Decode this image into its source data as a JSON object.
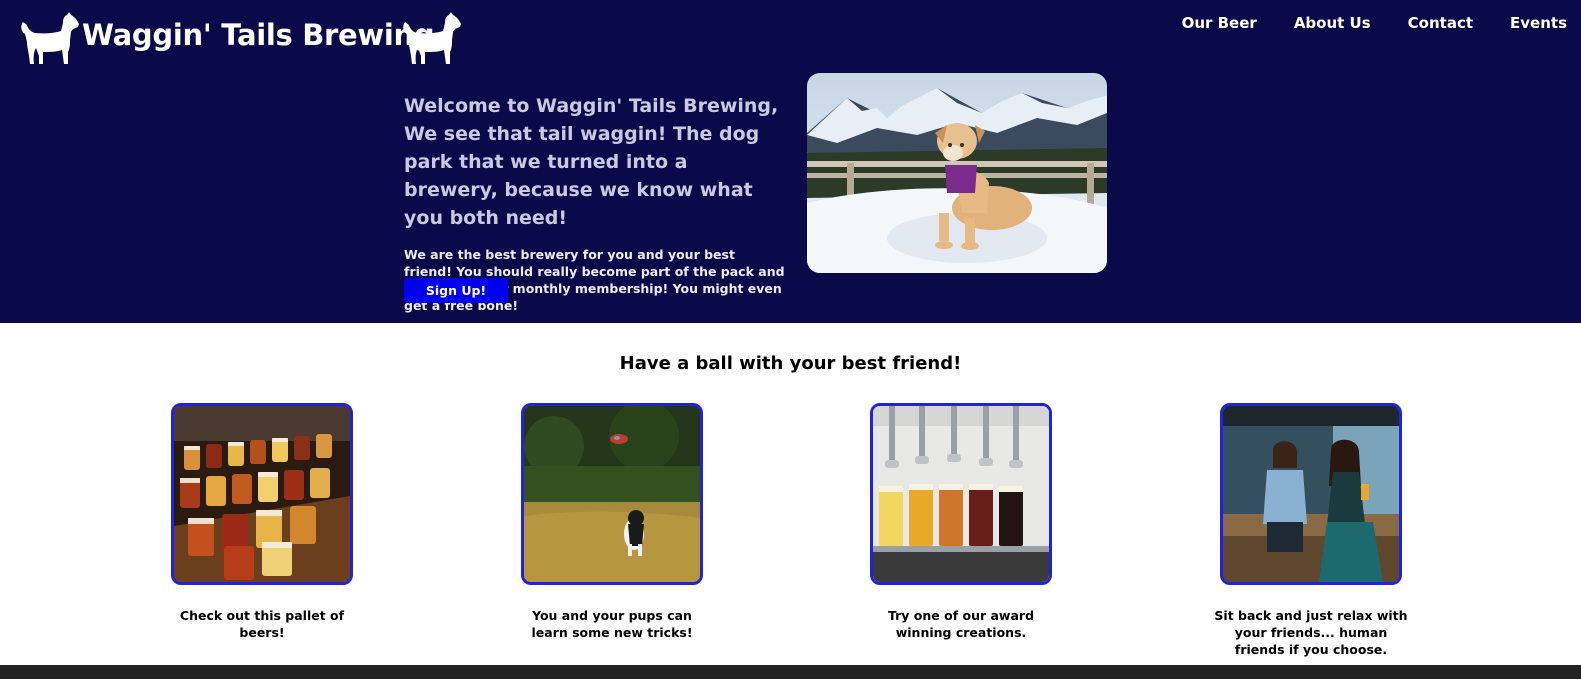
{
  "brand": {
    "title": "Waggin' Tails Brewing",
    "logo_icon": "dog-silhouette-icon"
  },
  "nav": {
    "items": [
      "Our Beer",
      "About Us",
      "Contact",
      "Events"
    ]
  },
  "hero": {
    "heading": "Welcome to Waggin' Tails Brewing, We see that tail waggin! The dog park that we turned into a brewery, because we know what you both need!",
    "text": "We are the best brewery for you and your best friend! You should really become part of the pack and sign up for our monthly membership! You might even get a free bone!",
    "signup_label": "Sign Up!"
  },
  "features": {
    "title": "Have a ball with your best friend!",
    "cards": [
      {
        "caption": "Check out this pallet of beers!"
      },
      {
        "caption": "You and your pups can learn some new tricks!"
      },
      {
        "caption": "Try one of our award winning creations."
      },
      {
        "caption": "Sit back and just relax with your friends... human friends if you choose."
      }
    ]
  },
  "colors": {
    "hero_bg": "#0a0a4b",
    "button": "#0000ee",
    "card_border": "#2222dd",
    "footer": "#222222"
  }
}
